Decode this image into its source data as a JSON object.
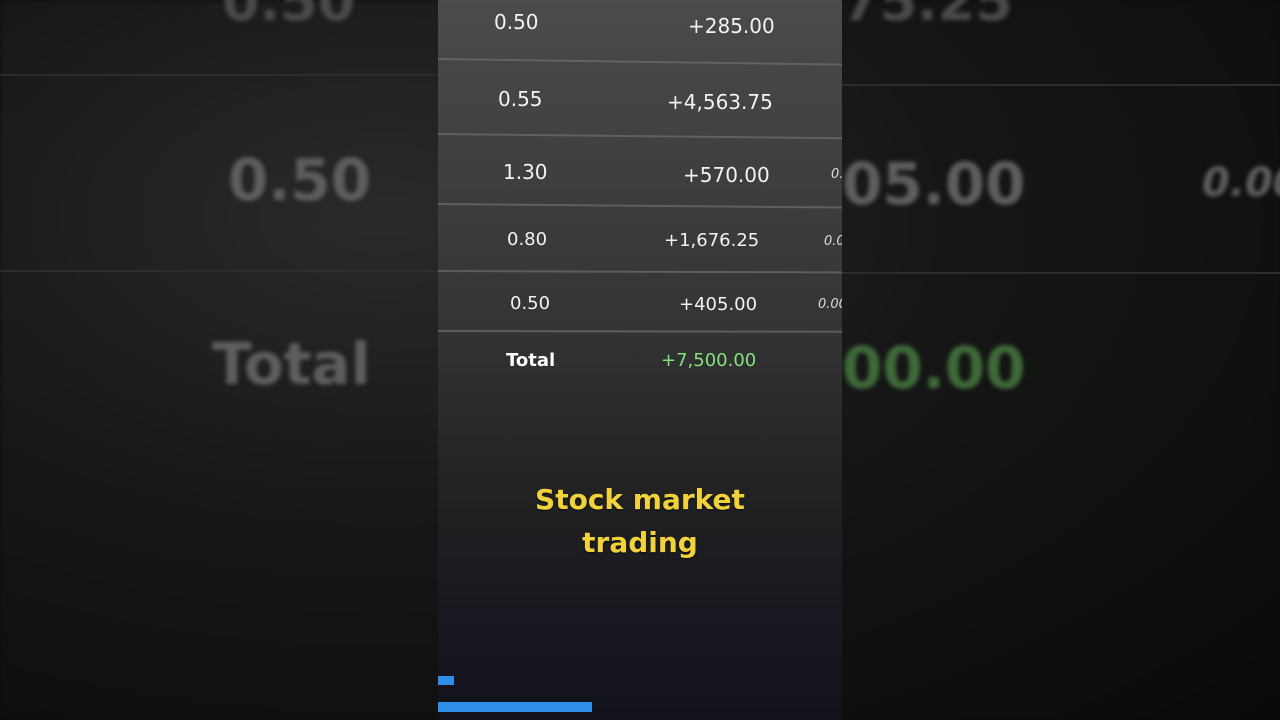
{
  "table": {
    "rows": [
      {
        "qty": "0.50",
        "pnl": "+285.00"
      },
      {
        "qty": "0.55",
        "pnl": "+4,563.75"
      },
      {
        "qty": "1.30",
        "pnl": "+570.00",
        "edge": "0."
      },
      {
        "qty": "0.80",
        "pnl": "+1,676.25",
        "edge": "0.0"
      },
      {
        "qty": "0.50",
        "pnl": "+405.00",
        "edge": "0.00"
      }
    ],
    "total_label": "Total",
    "total_value": "+7,500.00"
  },
  "caption": {
    "line1": "Stock market",
    "line2": "trading"
  },
  "background": {
    "left_value": "0.50",
    "left_label": "Total",
    "right_value": "05.00",
    "right_edge": "0.00",
    "right_total": "00.00",
    "top_left": "0.50",
    "top_right": "75.25"
  },
  "colors": {
    "caption": "#f2d23a",
    "total_value": "#84e27b",
    "progress": "#2f8fe8"
  },
  "progress": {
    "fraction": 0.38
  }
}
